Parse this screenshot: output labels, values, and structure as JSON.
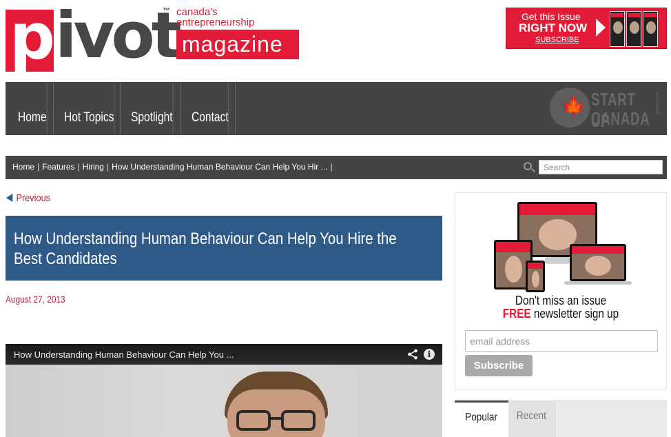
{
  "header": {
    "logo_word_p": "p",
    "logo_word_rest": "ivot",
    "logo_tm": "™",
    "tagline_line1": "canada's",
    "tagline_line2": "entrepreneurship",
    "logo_magazine": "magazine"
  },
  "ad": {
    "line1": "Get this Issue",
    "line2": "RIGHT NOW",
    "line3": "SUBSCRIBE",
    "colors": {
      "background": "#e31b37"
    }
  },
  "nav": {
    "items": [
      {
        "label": "Home"
      },
      {
        "label": "Hot Topics"
      },
      {
        "label": "Spotlight"
      },
      {
        "label": "Contact"
      }
    ],
    "partner_logo": {
      "line1": "START UP",
      "line2": "CANADA",
      "side": "MAGAZINE",
      "icon": "maple-leaf-icon"
    }
  },
  "breadcrumb": {
    "items": [
      "Home",
      "Features",
      "Hiring",
      "How Understanding Human Behaviour Can Help You Hir ..."
    ],
    "search_placeholder": "Search"
  },
  "article": {
    "previous_label": "Previous",
    "title": "How Understanding Human Behaviour Can Help You Hire the Best Candidates",
    "date": "August 27, 2013",
    "video_title": "How Understanding Human Behaviour Can Help You ...",
    "info_glyph": "i"
  },
  "sidebar": {
    "promo_line1": "Don't miss an issue",
    "promo_free": "FREE",
    "promo_line2_rest": " newsletter sign up",
    "email_placeholder": "email address",
    "subscribe_label": "Subscribe",
    "tabs": [
      "Popular",
      "Recent"
    ]
  },
  "colors": {
    "brand_red": "#e31b37",
    "nav_gray": "#444444",
    "title_blue": "#2f5a88",
    "date_red": "#c01d33"
  }
}
